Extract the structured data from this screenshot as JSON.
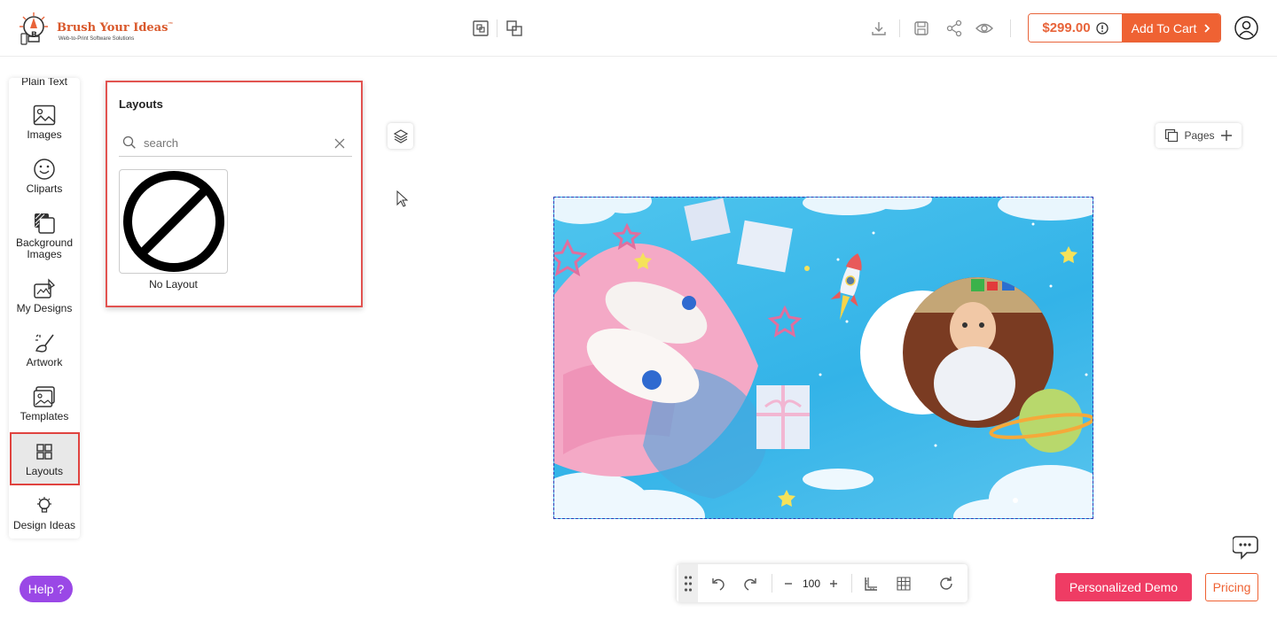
{
  "header": {
    "brand_name": "Brush Your Ideas",
    "brand_tm": "™",
    "brand_tagline": "Web-to-Print Software Solutions",
    "price": "$299.00",
    "add_to_cart": "Add To Cart"
  },
  "sidebar": {
    "items": [
      {
        "label": "Plain Text",
        "icon": "plain-text-icon"
      },
      {
        "label": "Images",
        "icon": "image-icon"
      },
      {
        "label": "Cliparts",
        "icon": "smiley-icon"
      },
      {
        "label": "Background Images",
        "icon": "background-icon"
      },
      {
        "label": "My Designs",
        "icon": "my-designs-icon"
      },
      {
        "label": "Artwork",
        "icon": "artwork-icon"
      },
      {
        "label": "Templates",
        "icon": "template-icon"
      },
      {
        "label": "Layouts",
        "icon": "grid-icon"
      },
      {
        "label": "Design Ideas",
        "icon": "lightbulb-icon"
      }
    ],
    "active": "Layouts"
  },
  "layouts_panel": {
    "title": "Layouts",
    "search_placeholder": "search",
    "search_value": "",
    "items": [
      {
        "label": "No Layout",
        "icon": "prohibited-icon"
      }
    ]
  },
  "canvas_tools": {
    "pages_label": "Pages"
  },
  "bottom_toolbar": {
    "zoom": "100"
  },
  "footer": {
    "help": "Help ?",
    "personalized_demo": "Personalized Demo",
    "pricing": "Pricing"
  },
  "colors": {
    "accent": "#ef6233",
    "highlight": "#e25350",
    "help": "#9a48e6",
    "demo": "#ef3c64"
  }
}
